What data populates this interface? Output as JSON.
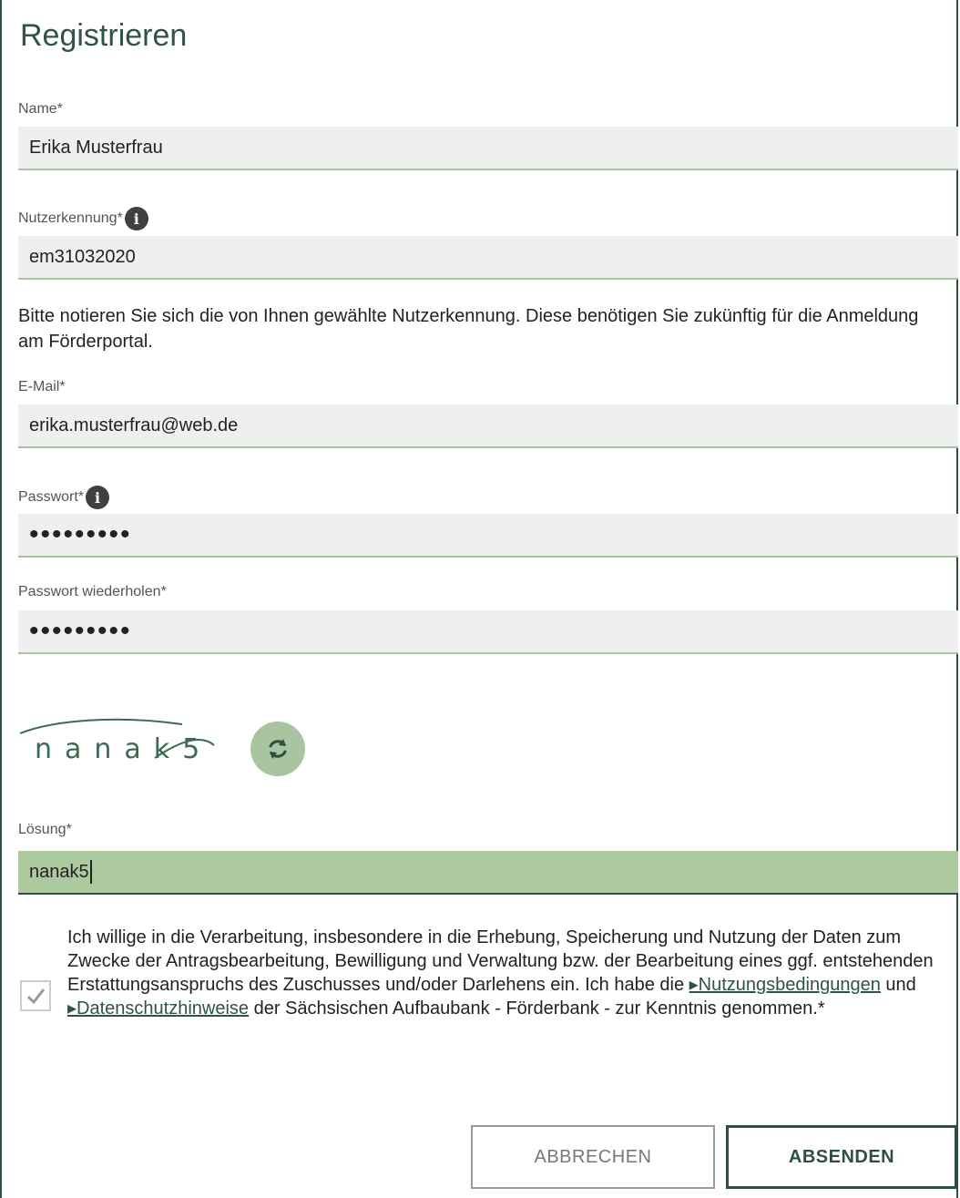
{
  "form": {
    "title": "Registrieren",
    "name": {
      "label": "Name*",
      "value": "Erika Musterfrau"
    },
    "username": {
      "label": "Nutzerkennung*",
      "value": "em31032020",
      "info": "i"
    },
    "note": "Bitte notieren Sie sich die von Ihnen gewählte Nutzerkennung. Diese benötigen Sie zukünftig für die Anmeldung am Förderportal.",
    "email": {
      "label": "E-Mail*",
      "value": "erika.musterfrau@web.de"
    },
    "password": {
      "label": "Passwort*",
      "value": "•••••••••",
      "info": "i"
    },
    "password_repeat": {
      "label": "Passwort wiederholen*",
      "value": "•••••••••"
    },
    "captcha": {
      "text": "nanak5",
      "refresh_icon": "refresh-icon"
    },
    "solution": {
      "label": "Lösung*",
      "value": "nanak5"
    },
    "consent": {
      "checked": true,
      "text_1": "Ich willige in die Verarbeitung, insbesondere in die Erhebung, Speicherung und Nutzung der Daten zum Zwecke der Antragsbearbeitung, Bewilligung und Verwaltung bzw. der Bearbeitung eines ggf. entstehenden Erstattungsanspruchs des Zuschusses und/oder Darlehens ein. Ich habe die ",
      "link_1": "▸Nutzungsbedingungen",
      "text_2": " und ",
      "link_2": "▸Datenschutzhinweise",
      "text_3": " der Sächsischen Aufbaubank - Förderbank - zur Kenntnis genommen.*"
    },
    "buttons": {
      "cancel": "ABBRECHEN",
      "submit": "ABSENDEN"
    }
  },
  "colors": {
    "accent": "#2e4f3f",
    "field_bg": "#efefef",
    "field_underline": "#a8c4a0",
    "active_field_bg": "#adc9a0"
  }
}
